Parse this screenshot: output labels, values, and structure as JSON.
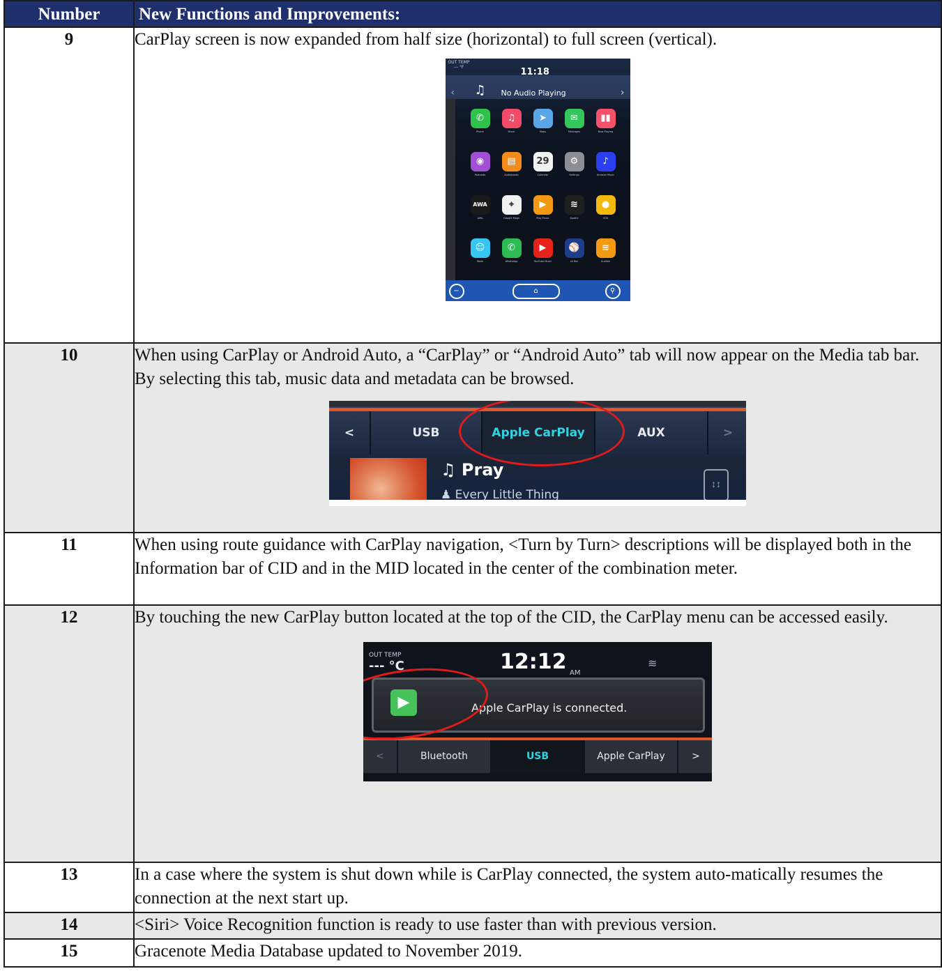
{
  "table": {
    "header": {
      "number": "Number",
      "description": "New Functions and Improvements:"
    },
    "rows": [
      {
        "number": "9",
        "text": "CarPlay screen is now expanded from half size (horizontal) to full screen (vertical)."
      },
      {
        "number": "10",
        "text": "When using CarPlay or Android Auto, a “CarPlay” or “Android Auto” tab will now appear on the Media tab bar. By selecting this tab, music data and metadata can be browsed."
      },
      {
        "number": "11",
        "text": "When using route guidance with CarPlay navigation, <Turn by Turn> descriptions will be displayed both in the Information bar of CID and in the MID located in the center of the combination meter."
      },
      {
        "number": "12",
        "text": "By touching the new CarPlay button located at the top of the CID, the CarPlay menu can be accessed easily."
      },
      {
        "number": "13",
        "text": "In a case where the system is shut down while is CarPlay connected, the system auto-matically resumes the connection at the next start up."
      },
      {
        "number": "14",
        "text": "<Siri> Voice Recognition function is ready to use faster than with previous version."
      },
      {
        "number": "15",
        "text": "Gracenote Media Database updated to November 2019."
      }
    ]
  },
  "fig_carplay_home": {
    "out_temp_label": "OUT TEMP",
    "out_temp_value": "--- °F",
    "clock": "11:18",
    "now_playing": "No Audio Playing",
    "apps": [
      {
        "label": "Phone",
        "icon": "phone-icon",
        "color": "#2fc24a",
        "glyph": "✆"
      },
      {
        "label": "Music",
        "icon": "music-icon",
        "color": "#f24b6a",
        "glyph": "♫"
      },
      {
        "label": "Maps",
        "icon": "maps-icon",
        "color": "#5aa6e8",
        "glyph": "➤"
      },
      {
        "label": "Messages",
        "icon": "messages-icon",
        "color": "#35c759",
        "glyph": "✉"
      },
      {
        "label": "Now Playing",
        "icon": "now-playing-icon",
        "color": "#f6506b",
        "glyph": "▮▮"
      },
      {
        "label": "Podcasts",
        "icon": "podcasts-icon",
        "color": "#a24fd6",
        "glyph": "◉"
      },
      {
        "label": "Audiobooks",
        "icon": "audiobooks-icon",
        "color": "#f28a1c",
        "glyph": "▤"
      },
      {
        "label": "Calendar",
        "icon": "calendar-icon",
        "color": "#f2f2f2",
        "glyph": "29"
      },
      {
        "label": "Settings",
        "icon": "settings-icon",
        "color": "#8d8d93",
        "glyph": "⚙"
      },
      {
        "label": "Amazon Music",
        "icon": "amazon-music-icon",
        "color": "#2c3ff0",
        "glyph": "♪"
      },
      {
        "label": "AWA",
        "icon": "awa-icon",
        "color": "#1a1a1a",
        "glyph": "AWA"
      },
      {
        "label": "Google Maps",
        "icon": "google-maps-icon",
        "color": "#f1f1f1",
        "glyph": "⌖"
      },
      {
        "label": "Play Music",
        "icon": "play-music-icon",
        "color": "#f39a12",
        "glyph": "▶"
      },
      {
        "label": "Spotify",
        "icon": "spotify-icon",
        "color": "#1f1f1f",
        "glyph": "≋"
      },
      {
        "label": "VOX",
        "icon": "vox-icon",
        "color": "#f4b90e",
        "glyph": "●"
      },
      {
        "label": "Waze",
        "icon": "waze-icon",
        "color": "#36c5f0",
        "glyph": "☺"
      },
      {
        "label": "WhatsApp",
        "icon": "whatsapp-icon",
        "color": "#2dbb53",
        "glyph": "✆"
      },
      {
        "label": "YouTube Music",
        "icon": "youtube-music-icon",
        "color": "#e62117",
        "glyph": "▶"
      },
      {
        "label": "At Bat",
        "icon": "at-bat-icon",
        "color": "#1e3d8a",
        "glyph": "⚾"
      },
      {
        "label": "Audible",
        "icon": "audible-icon",
        "color": "#f39a12",
        "glyph": "≋"
      }
    ]
  },
  "fig_media_tabs": {
    "tabs": [
      "USB",
      "Apple CarPlay",
      "AUX"
    ],
    "song": "Pray",
    "artist": "Every Little Thing"
  },
  "fig_connected": {
    "out_temp_label": "OUT TEMP",
    "temp_value": "--- °C",
    "clock": "12:12",
    "ampm": "AM",
    "message": "Apple CarPlay is connected.",
    "tabs": [
      "Bluetooth",
      "USB",
      "Apple CarPlay"
    ]
  },
  "colors": {
    "header_bg": "#1f2f6c",
    "grey_row": "#e8e8e9",
    "highlight_circle": "#e01b1b",
    "accent_orange": "#e0562a",
    "active_tab_text": "#31d3e0"
  }
}
